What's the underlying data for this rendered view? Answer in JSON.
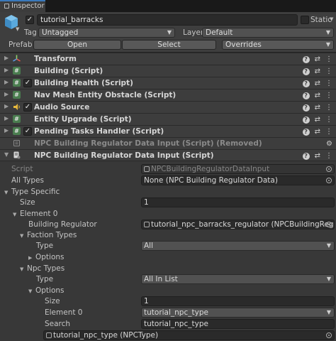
{
  "tab": {
    "label": "Inspector"
  },
  "header": {
    "object_name": "tutorial_barracks",
    "static_label": "Static",
    "tag_label": "Tag",
    "tag_value": "Untagged",
    "layer_label": "Layer",
    "layer_value": "Default",
    "prefab_label": "Prefab",
    "open_label": "Open",
    "select_label": "Select",
    "overrides_label": "Overrides"
  },
  "components": [
    {
      "title": "Transform"
    },
    {
      "title": "Building (Script)"
    },
    {
      "title": "Building Health (Script)"
    },
    {
      "title": "Nav Mesh Entity Obstacle (Script)"
    },
    {
      "title": "Audio Source"
    },
    {
      "title": "Entity Upgrade (Script)"
    },
    {
      "title": "Pending Tasks Handler (Script)"
    },
    {
      "title": "NPC Building Regulator Data Input (Script) (Removed)"
    },
    {
      "title": "NPC Building Regulator Data Input (Script)"
    }
  ],
  "props": {
    "script_label": "Script",
    "script_value": "NPCBuildingRegulatorDataInput",
    "all_types_label": "All Types",
    "all_types_value": "None (NPC Building Regulator Data)",
    "type_specific_label": "Type Specific",
    "size_label": "Size",
    "size_value": "1",
    "element0_label": "Element 0",
    "building_regulator_label": "Building Regulator",
    "building_regulator_value": "tutorial_npc_barracks_regulator (NPCBuildingRegulatorDa",
    "faction_types_label": "Faction Types",
    "faction_type_label": "Type",
    "faction_type_value": "All",
    "faction_options_label": "Options",
    "npc_types_label": "Npc Types",
    "npc_type_label": "Type",
    "npc_type_value": "All In List",
    "npc_options_label": "Options",
    "options_size_label": "Size",
    "options_size_value": "1",
    "options_element0_label": "Element 0",
    "options_element0_value": "tutorial_npc_type",
    "search_label": "Search",
    "search_value": "tutorial_npc_type",
    "result_value": "tutorial_npc_type (NPCType)"
  },
  "colors": {
    "accent": "#3a79bb",
    "script_icon": "#4a7d4f",
    "panel": "#383838"
  }
}
